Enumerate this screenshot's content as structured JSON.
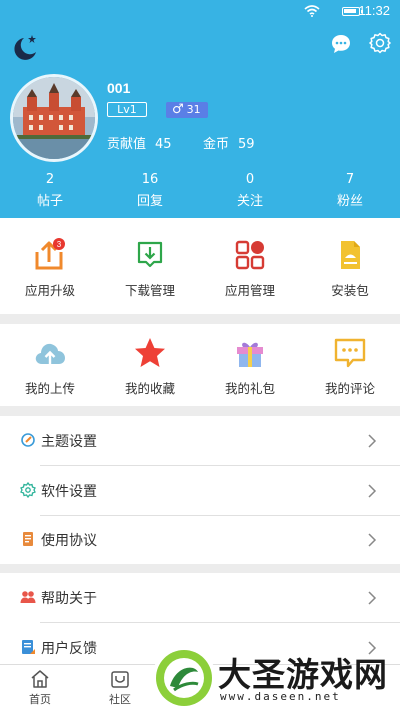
{
  "status_bar": {
    "time": "11:32"
  },
  "profile": {
    "username": "001",
    "level": "Lv1",
    "gender_symbol": "♂",
    "age": "31",
    "contribution_label": "贡献值",
    "contribution_value": "45",
    "coins_label": "金币",
    "coins_value": "59"
  },
  "stats": [
    {
      "value": "2",
      "label": "帖子"
    },
    {
      "value": "16",
      "label": "回复"
    },
    {
      "value": "0",
      "label": "关注"
    },
    {
      "value": "7",
      "label": "粉丝"
    }
  ],
  "tools": [
    {
      "label": "应用升级",
      "icon": "upgrade-icon",
      "badge": "3"
    },
    {
      "label": "下载管理",
      "icon": "download-icon"
    },
    {
      "label": "应用管理",
      "icon": "apps-icon"
    },
    {
      "label": "安装包",
      "icon": "apk-icon"
    }
  ],
  "personal": [
    {
      "label": "我的上传",
      "icon": "cloud-upload-icon"
    },
    {
      "label": "我的收藏",
      "icon": "star-icon"
    },
    {
      "label": "我的礼包",
      "icon": "gift-icon"
    },
    {
      "label": "我的评论",
      "icon": "comment-icon"
    }
  ],
  "settings": [
    {
      "label": "主题设置",
      "icon": "theme-icon"
    },
    {
      "label": "软件设置",
      "icon": "settings-icon"
    },
    {
      "label": "使用协议",
      "icon": "agreement-icon"
    }
  ],
  "support": [
    {
      "label": "帮助关于",
      "icon": "help-icon"
    },
    {
      "label": "用户反馈",
      "icon": "feedback-icon"
    }
  ],
  "bottom_nav": [
    {
      "label": "首页",
      "icon": "home-icon"
    },
    {
      "label": "社区",
      "icon": "community-icon"
    }
  ],
  "watermark": {
    "title": "大圣游戏网",
    "url": "www.daseen.net"
  },
  "colors": {
    "header": "#37b3e4",
    "badge_red": "#e8382f",
    "gender_badge": "#5a7fe6"
  }
}
